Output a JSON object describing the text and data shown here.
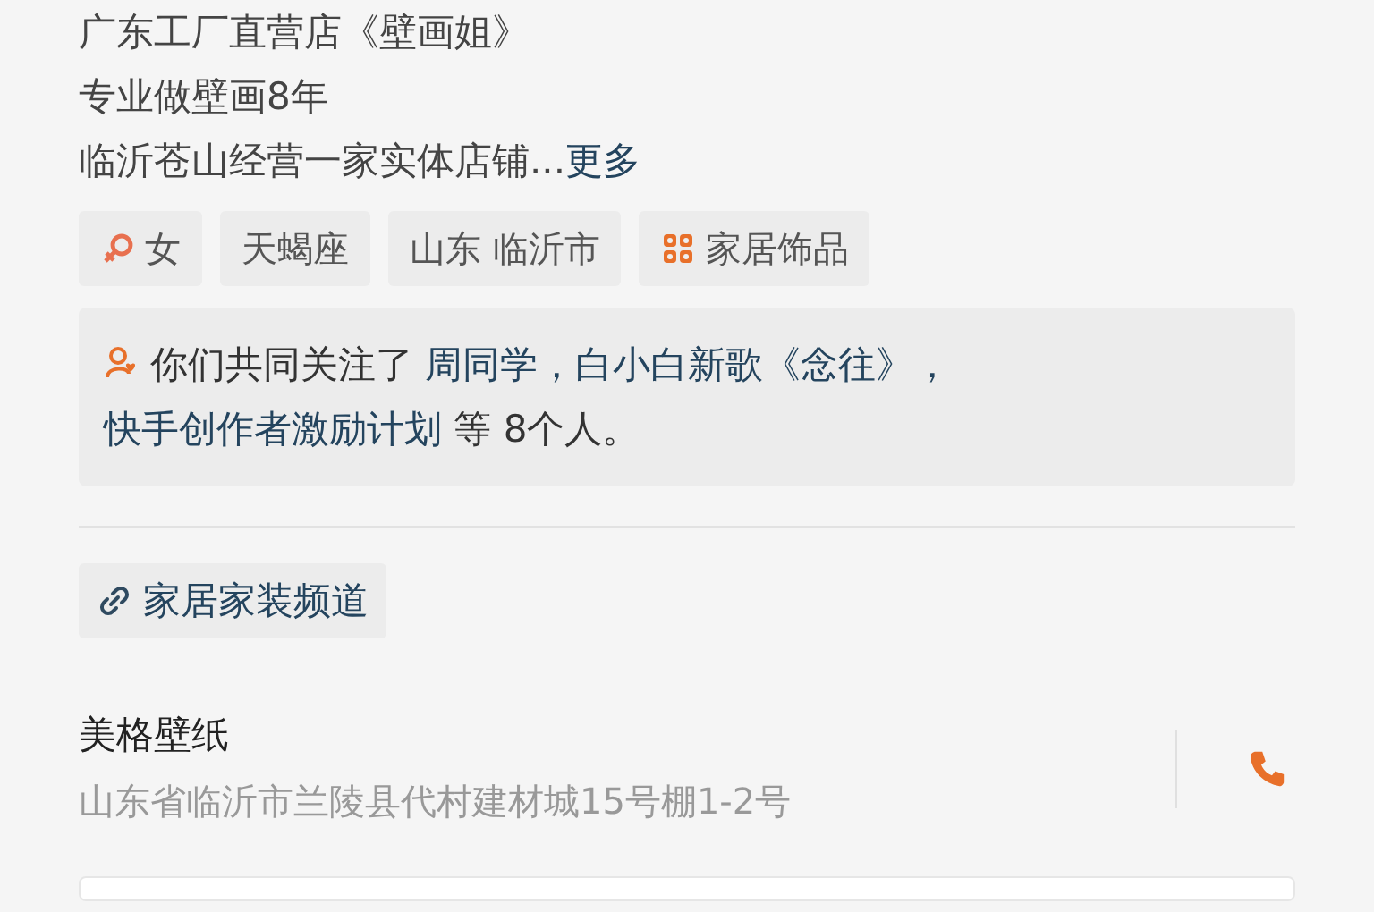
{
  "bio_lines": [
    "广东工厂直营店《壁画姐》",
    "专业做壁画8年"
  ],
  "bio_last": {
    "text": "临沂苍山经营一家实体店铺...",
    "more": "更多"
  },
  "tags": [
    {
      "kind": "gender",
      "label": "女"
    },
    {
      "kind": "plain",
      "label": "天蝎座"
    },
    {
      "kind": "plain",
      "label": "山东 临沂市"
    },
    {
      "kind": "category",
      "label": "家居饰品"
    }
  ],
  "mutual": {
    "prefix": "你们共同关注了",
    "names": [
      "周同学，",
      "白小白新歌《念往》，",
      "快手创作者激励计划"
    ],
    "suffix": "等 8个人。"
  },
  "channel_link": "家居家装频道",
  "shop": {
    "name": "美格壁纸",
    "address": "山东省临沂市兰陵县代村建材城15号棚1-2号"
  }
}
